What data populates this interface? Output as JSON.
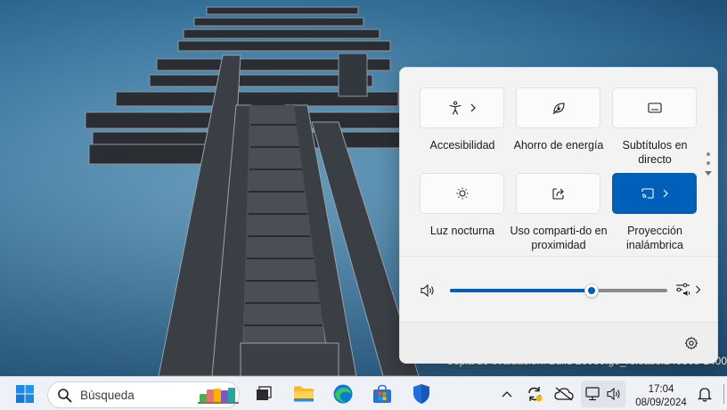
{
  "desktop": {
    "watermark": "Copia de evaluación. Build 26080.ge_release.240308-1400"
  },
  "quick_settings": {
    "tiles": [
      {
        "label": "Accesibilidad",
        "icon": "accessibility-icon",
        "has_chevron": true,
        "active": false
      },
      {
        "label": "Ahorro de energía",
        "icon": "energy-saver-icon",
        "has_chevron": false,
        "active": false
      },
      {
        "label": "Subtítulos en directo",
        "icon": "live-captions-icon",
        "has_chevron": false,
        "active": false
      },
      {
        "label": "Luz nocturna",
        "icon": "night-light-icon",
        "has_chevron": false,
        "active": false
      },
      {
        "label": "Uso comparti-do en proximidad",
        "icon": "nearby-share-icon",
        "has_chevron": false,
        "active": false
      },
      {
        "label": "Proyección inalámbrica",
        "icon": "cast-icon",
        "has_chevron": true,
        "active": true
      }
    ],
    "volume": {
      "level": 0.65,
      "icon": "speaker-icon",
      "mixer_icon": "audio-mixer-icon"
    },
    "settings_icon": "settings-gear-icon",
    "accent_color": "#005fb8"
  },
  "taskbar": {
    "search_placeholder": "Búsqueda",
    "apps": [
      "start-icon",
      "search-icon",
      "widgets-icon",
      "task-view-icon",
      "file-explorer-icon",
      "edge-icon",
      "store-icon",
      "defender-icon"
    ],
    "tray_icons": [
      "chevron-up-icon",
      "sync-icon",
      "cloud-icon",
      "network-icon",
      "volume-icon",
      "notification-bell-icon"
    ],
    "time": "17:04",
    "date": "08/09/2024"
  }
}
